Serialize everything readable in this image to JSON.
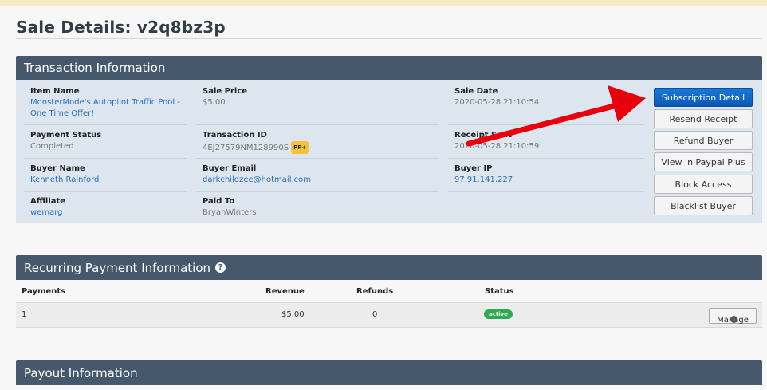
{
  "page": {
    "title": "Sale Details: v2q8bz3p"
  },
  "transaction": {
    "header": "Transaction Information",
    "item_name": {
      "label": "Item Name",
      "value": "MonsterMode's Autopilot Traffic Pool - One Time Offer!"
    },
    "sale_price": {
      "label": "Sale Price",
      "value": "$5.00"
    },
    "sale_date": {
      "label": "Sale Date",
      "value": "2020-05-28 21:10:54"
    },
    "payment_status": {
      "label": "Payment Status",
      "value": "Completed"
    },
    "transaction_id": {
      "label": "Transaction ID",
      "value": "4EJ27579NM128990S",
      "badge": "PP+"
    },
    "receipt_sent": {
      "label": "Receipt Sent",
      "value": "2020-05-28 21:10:59"
    },
    "buyer_name": {
      "label": "Buyer Name",
      "value": "Kenneth Rainford"
    },
    "buyer_email": {
      "label": "Buyer Email",
      "value": "darkchildzee@hotmail.com"
    },
    "buyer_ip": {
      "label": "Buyer IP",
      "value": "97.91.141.227"
    },
    "affiliate": {
      "label": "Affiliate",
      "value": "wemarg"
    },
    "paid_to": {
      "label": "Paid To",
      "value": "BryanWinters"
    }
  },
  "actions": {
    "subscription_detail": "Subscription Detail",
    "resend_receipt": "Resend Receipt",
    "refund_buyer": "Refund Buyer",
    "view_paypal_plus": "View in Paypal Plus",
    "block_access": "Block Access",
    "blacklist_buyer": "Blacklist Buyer"
  },
  "recurring": {
    "header": "Recurring Payment Information",
    "help_icon": "?",
    "columns": {
      "payments": "Payments",
      "revenue": "Revenue",
      "refunds": "Refunds",
      "status": "Status"
    },
    "row": {
      "payments": "1",
      "revenue": "$5.00",
      "refunds": "0",
      "status": "active",
      "manage": "Manage"
    }
  },
  "payout": {
    "header": "Payout Information"
  },
  "colors": {
    "panel_header": "#46596c",
    "primary_button": "#0b59b7",
    "annotation_arrow": "#e8000b",
    "active_badge": "#2eaa4f",
    "pp_badge": "#f6c23a"
  }
}
